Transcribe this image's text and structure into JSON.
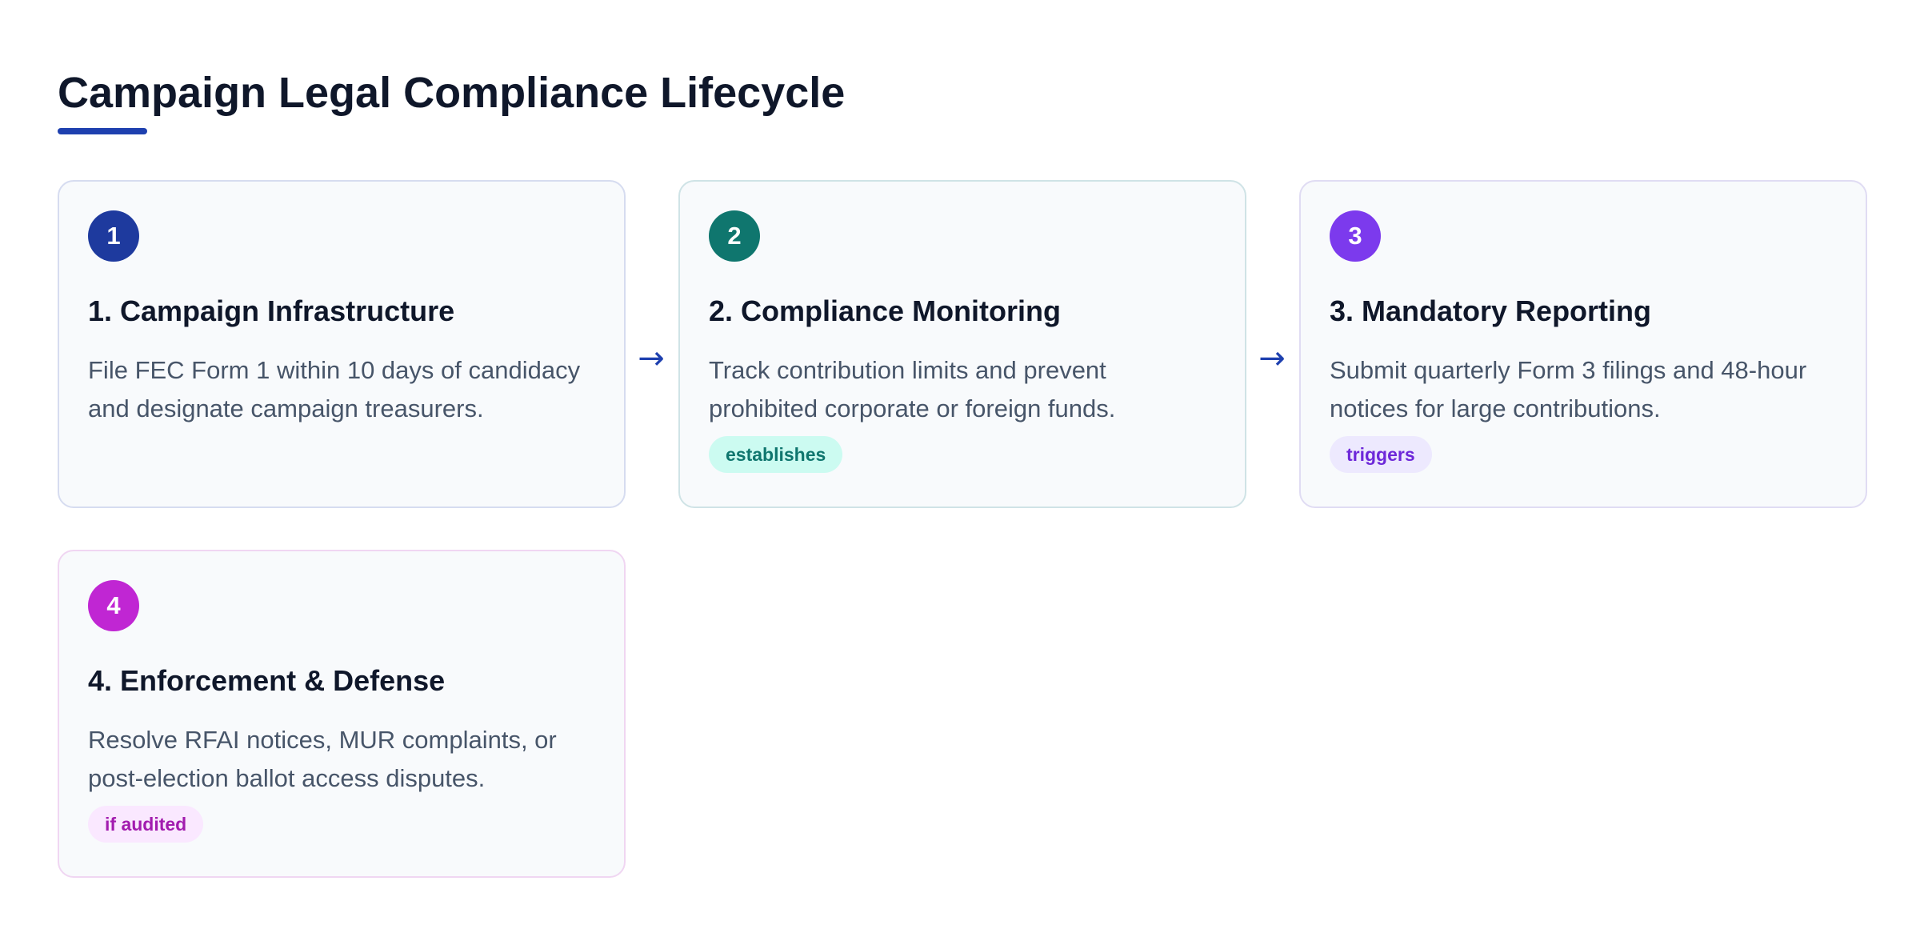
{
  "title": "Campaign Legal Compliance Lifecycle",
  "colors": {
    "accent": "#1e40af",
    "step1": "#1e3a9e",
    "step2": "#0f766e",
    "step3": "#7c3aed",
    "step4": "#c026d3"
  },
  "arrow_glyph": "→",
  "steps": [
    {
      "number": "1",
      "title": "1. Campaign Infrastructure",
      "description": "File FEC Form 1 within 10 days of candidacy and designate campaign treasurers.",
      "tag": ""
    },
    {
      "number": "2",
      "title": "2. Compliance Monitoring",
      "description": "Track contribution limits and prevent prohibited corporate or foreign funds.",
      "tag": "establishes"
    },
    {
      "number": "3",
      "title": "3. Mandatory Reporting",
      "description": "Submit quarterly Form 3 filings and 48-hour notices for large contributions.",
      "tag": "triggers"
    },
    {
      "number": "4",
      "title": "4. Enforcement & Defense",
      "description": "Resolve RFAI notices, MUR complaints, or post-election ballot access disputes.",
      "tag": "if audited"
    }
  ]
}
